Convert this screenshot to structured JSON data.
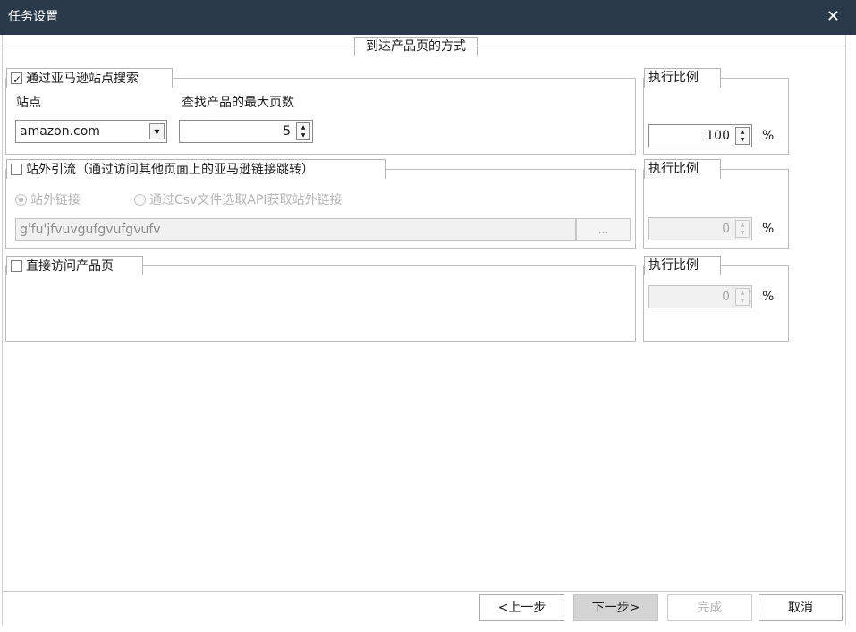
{
  "window": {
    "title": "任务设置"
  },
  "header": {
    "section_title": "到达产品页的方式"
  },
  "amazon_search": {
    "checkbox_label": "通过亚马逊站点搜索",
    "checked": true,
    "site_label": "站点",
    "site_value": "amazon.com",
    "max_pages_label": "查找产品的最大页数",
    "max_pages_value": "5",
    "ratio_title": "执行比例",
    "ratio_value": "100",
    "ratio_unit": "%"
  },
  "external_traffic": {
    "checkbox_label": "站外引流（通过访问其他页面上的亚马逊链接跳转）",
    "checked": false,
    "radio_external_link": "站外链接",
    "radio_csv_api": "通过Csv文件选取API获取站外链接",
    "link_value": "g'fu'jfvuvgufgvufgvufv",
    "browse_label": "...",
    "ratio_title": "执行比例",
    "ratio_value": "0",
    "ratio_unit": "%"
  },
  "direct_visit": {
    "checkbox_label": "直接访问产品页",
    "checked": false,
    "ratio_title": "执行比例",
    "ratio_value": "0",
    "ratio_unit": "%"
  },
  "footer": {
    "prev_label": "<上一步",
    "next_label": "下一步>",
    "finish_label": "完成",
    "cancel_label": "取消"
  },
  "icons": {
    "close": "close-icon",
    "dropdown": "chevron-down-icon",
    "spin": "spin-arrows-icon"
  }
}
